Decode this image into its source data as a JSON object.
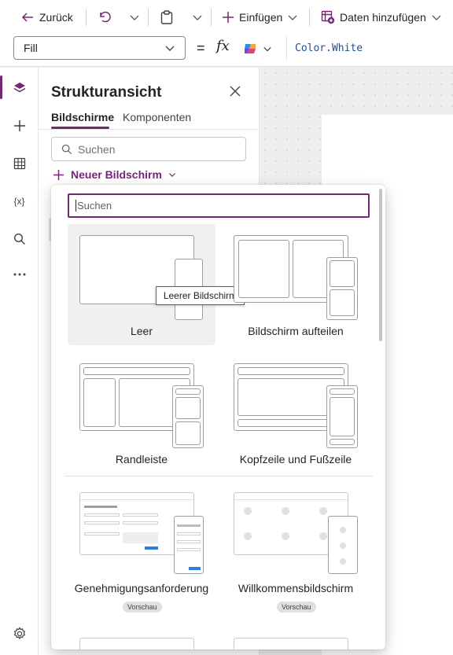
{
  "toolbar": {
    "back_label": "Zurück",
    "insert_label": "Einfügen",
    "add_data_label": "Daten hinzufügen"
  },
  "formula_bar": {
    "property": "Fill",
    "equals": "=",
    "fx": "fx",
    "formula_value": "Color.White"
  },
  "tree_view": {
    "title": "Strukturansicht",
    "tabs": [
      {
        "label": "Bildschirme",
        "active": true
      },
      {
        "label": "Komponenten",
        "active": false
      }
    ],
    "search_placeholder": "Suchen",
    "new_screen_label": "Neuer Bildschirm"
  },
  "new_screen_popup": {
    "search_placeholder": "Suchen",
    "tooltip": "Leerer Bildschirm",
    "templates": [
      {
        "label": "Leer",
        "selected": true
      },
      {
        "label": "Bildschirm aufteilen"
      },
      {
        "label": "Randleiste"
      },
      {
        "label": "Kopfzeile und Fußzeile"
      },
      {
        "label": "Genehmigungsanforderung",
        "badge": "Vorschau"
      },
      {
        "label": "Willkommensbildschirm",
        "badge": "Vorschau"
      }
    ]
  },
  "colors": {
    "accent": "#742774",
    "selected_tile": "#f0f0f0",
    "formula_text": "#1f4f8f"
  }
}
